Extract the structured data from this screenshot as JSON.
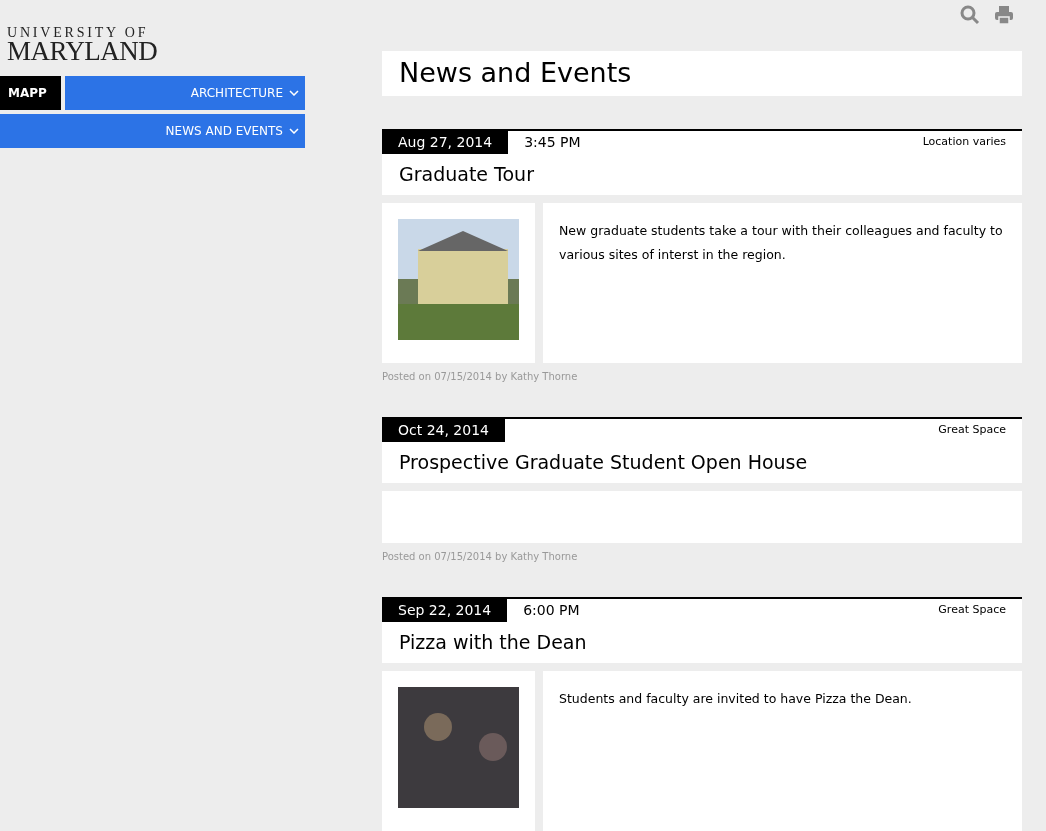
{
  "logo": {
    "line_1": "UNIVERSITY OF",
    "line_2": "MARYLAND"
  },
  "nav": {
    "home": "MAPP",
    "items": [
      {
        "label": "ARCHITECTURE"
      },
      {
        "label": "NEWS AND EVENTS"
      }
    ]
  },
  "page_title": "News and Events",
  "events": [
    {
      "date": "Aug 27, 2014",
      "time": "3:45 PM",
      "location": "Location varies",
      "title": "Graduate Tour",
      "has_image": true,
      "description": "New graduate students take a tour with their colleagues and faculty to various sites of interst in the region.",
      "posted": "Posted on 07/15/2014 by Kathy Thorne"
    },
    {
      "date": "Oct 24, 2014",
      "location": "Great Space",
      "title": "Prospective Graduate Student Open House",
      "has_image": false,
      "posted": "Posted on 07/15/2014 by Kathy Thorne"
    },
    {
      "date": "Sep 22, 2014",
      "time": "6:00 PM",
      "location": "Great Space",
      "title": "Pizza with the Dean",
      "has_image": true,
      "description": "Students and faculty are invited to have Pizza the Dean."
    }
  ]
}
